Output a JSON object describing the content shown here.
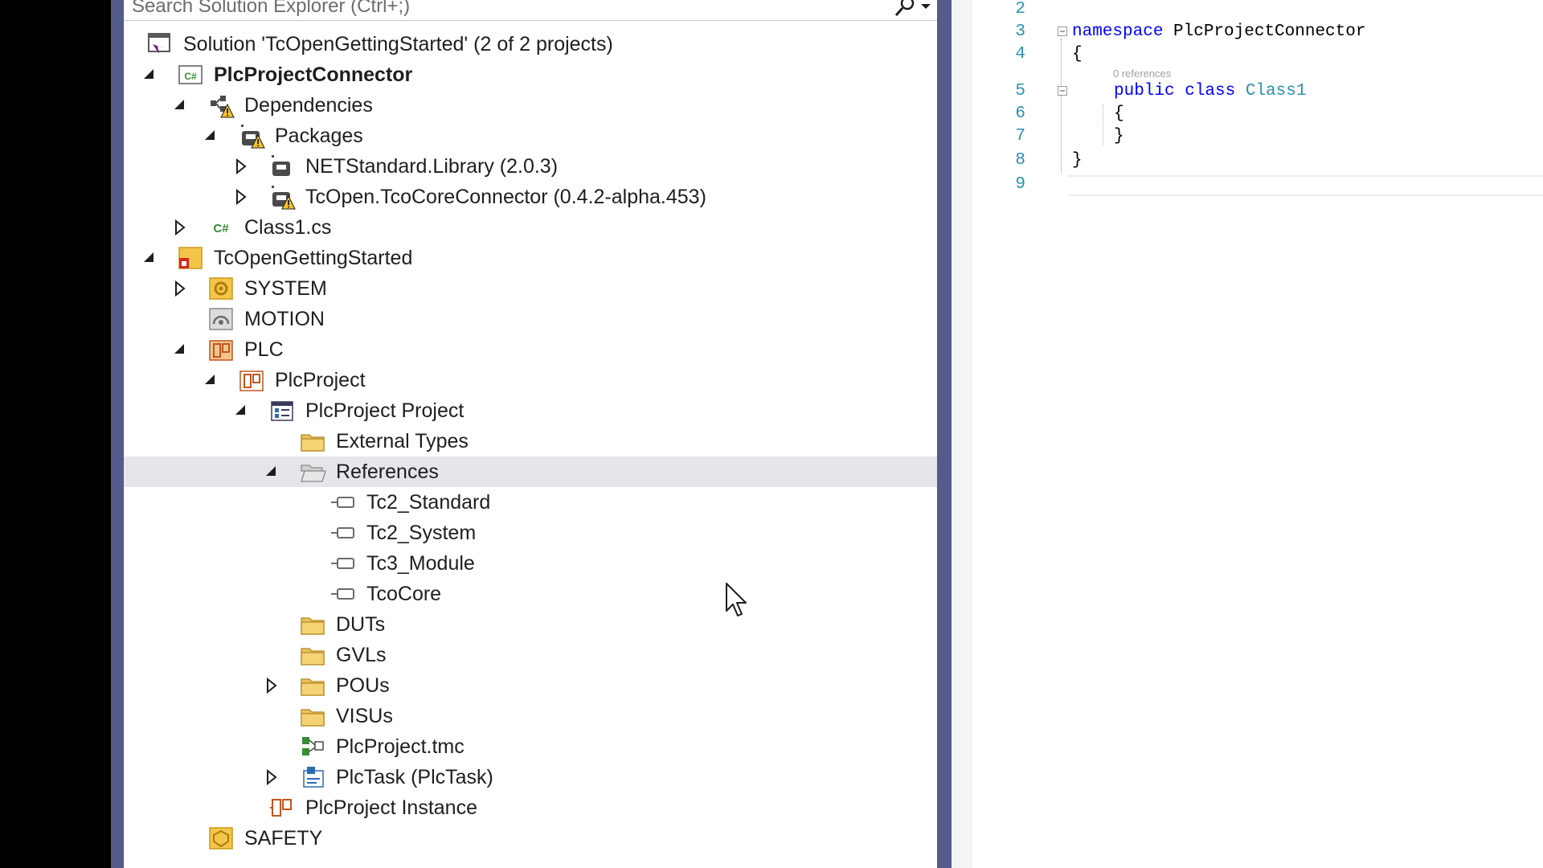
{
  "search": {
    "placeholder": "Search Solution Explorer (Ctrl+;)"
  },
  "tree": {
    "solution": "Solution 'TcOpenGettingStarted' (2 of 2 projects)",
    "plc_project_connector": "PlcProjectConnector",
    "dependencies": "Dependencies",
    "packages": "Packages",
    "netstandard": "NETStandard.Library (2.0.3)",
    "tcocore_connector": "TcOpen.TcoCoreConnector (0.4.2-alpha.453)",
    "class1_cs": "Class1.cs",
    "tc_open_getting_started": "TcOpenGettingStarted",
    "system": "SYSTEM",
    "motion": "MOTION",
    "plc": "PLC",
    "plc_project": "PlcProject",
    "plc_project_project": "PlcProject Project",
    "external_types": "External Types",
    "references": "References",
    "tc2_standard": "Tc2_Standard",
    "tc2_system": "Tc2_System",
    "tc3_module": "Tc3_Module",
    "tcocore": "TcoCore",
    "duts": "DUTs",
    "gvls": "GVLs",
    "pous": "POUs",
    "visus": "VISUs",
    "plc_project_tmc": "PlcProject.tmc",
    "plc_task": "PlcTask (PlcTask)",
    "plc_project_instance": "PlcProject Instance",
    "safety": "SAFETY"
  },
  "editor": {
    "lines": [
      {
        "number": "2"
      },
      {
        "number": "3",
        "keyword": "namespace",
        "name": " PlcProjectConnector"
      },
      {
        "number": "4",
        "text": "{"
      },
      {
        "number": "5",
        "keyword": "public class",
        "type": "Class1"
      },
      {
        "number": "6",
        "text": "{"
      },
      {
        "number": "7",
        "text": "}"
      },
      {
        "number": "8",
        "text": "}"
      },
      {
        "number": "9"
      }
    ],
    "codelens": "0 references"
  },
  "colors": {
    "frame": "#535a8c",
    "keyword": "#0000ff",
    "type": "#2b91af",
    "line_number": "#2b91af",
    "selection": "#e5e5ea",
    "folder": "#e8c25a"
  }
}
